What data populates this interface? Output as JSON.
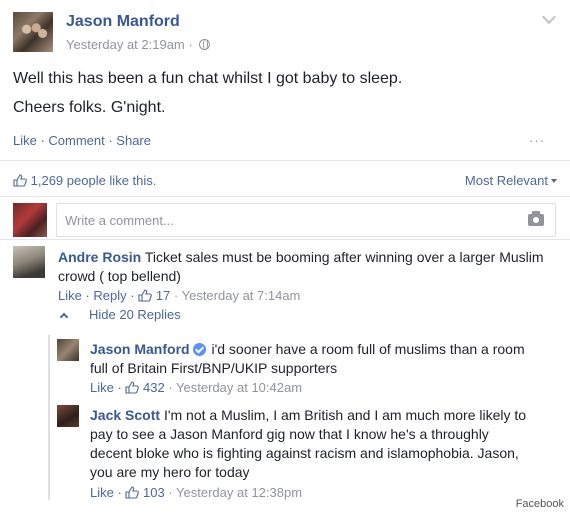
{
  "post": {
    "author": "Jason Manford",
    "timestamp": "Yesterday at 2:19am",
    "separator": "·",
    "line1": "Well this has been a fun chat whilst I got baby to sleep.",
    "line2": "Cheers folks. G'night.",
    "actions": "Like · Comment · Share",
    "more": "···"
  },
  "reactions": {
    "likes_text": "1,269 people like this.",
    "sort_label": "Most Relevant"
  },
  "composer": {
    "placeholder": "Write a comment..."
  },
  "comments": [
    {
      "author": "Andre Rosin",
      "text_line1": "Ticket sales must be booming after winning over a larger Muslim",
      "text_line2": "crowd ( top bellend)",
      "actions": "Like · Reply · ",
      "likes": "17",
      "time": " · Yesterday at 7:14am"
    }
  ],
  "replies_toggle": "Hide 20 Replies",
  "replies": [
    {
      "author": "Jason Manford",
      "text_line1": "i'd sooner have a room full of muslims than a room",
      "text_line2": "full of Britain First/BNP/UKIP supporters",
      "actions": "Like · ",
      "likes": "432",
      "time": " · Yesterday at 10:42am"
    },
    {
      "author": "Jack Scott",
      "text_line1": "I'm not a Muslim, I am British and I am much more likely to",
      "text_line2": "pay to see a Jason Manford gig now that I know he's a throughly",
      "text_line3": "decent bloke who is fighting against racism and islamophobia. Jason,",
      "text_line4": "you are my hero for today",
      "actions": "Like · ",
      "likes": "103",
      "time": " · Yesterday at 12:38pm"
    }
  ],
  "credit": "Facebook",
  "colors": {
    "link": "#365899",
    "meta": "#90949c",
    "action": "#4b67a1"
  }
}
